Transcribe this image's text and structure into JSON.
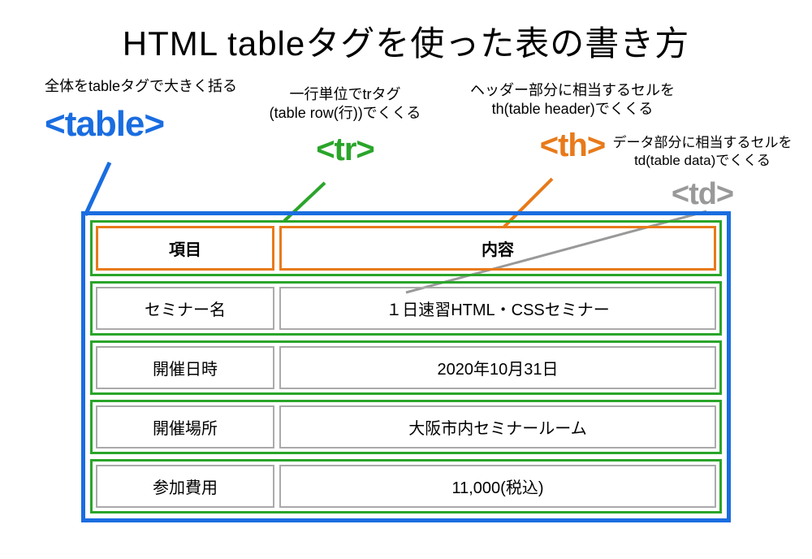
{
  "title": "HTML tableタグを使った表の書き方",
  "annotations": {
    "table": {
      "desc": "全体をtableタグで大きく括る",
      "tag": "<table>"
    },
    "tr": {
      "desc": "一行単位でtrタグ\n(table row(行))でくくる",
      "tag": "<tr>"
    },
    "th": {
      "desc": "ヘッダー部分に相当するセルを\nth(table header)でくくる",
      "tag": "<th>"
    },
    "td": {
      "desc": "データ部分に相当するセルを\ntd(table data)でくくる",
      "tag": "<td>"
    }
  },
  "table": {
    "headers": {
      "col1": "項目",
      "col2": "内容"
    },
    "rows": [
      {
        "col1": "セミナー名",
        "col2": "１日速習HTML・CSSセミナー"
      },
      {
        "col1": "開催日時",
        "col2": "2020年10月31日"
      },
      {
        "col1": "開催場所",
        "col2": "大阪市内セミナールーム"
      },
      {
        "col1": "参加費用",
        "col2": "11,000(税込)"
      }
    ]
  },
  "colors": {
    "table": "#1a6de0",
    "tr": "#2aa52a",
    "th": "#e87a1a",
    "td": "#999999"
  }
}
